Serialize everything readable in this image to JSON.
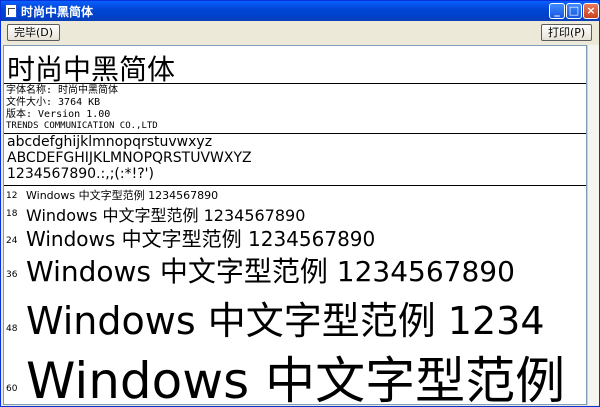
{
  "window": {
    "title": "时尚中黑简体"
  },
  "toolbar": {
    "done_label": "完毕(D)",
    "print_label": "打印(P)"
  },
  "preview": {
    "font_name": "时尚中黑简体",
    "info": [
      "字体名称: 时尚中黑简体",
      "文件大小: 3764 KB",
      "版本: Version  1.00",
      "TRENDS COMMUNICATION CO.,LTD"
    ],
    "lowercase": "abcdefghijklmnopqrstuvwxyz",
    "uppercase": "ABCDEFGHIJKLMNOPQRSTUVWXYZ",
    "digits": "1234567890.:,;(:*!?')",
    "samples": [
      {
        "size": "12",
        "text": "Windows 中文字型范例 1234567890"
      },
      {
        "size": "18",
        "text": "Windows 中文字型范例 1234567890"
      },
      {
        "size": "24",
        "text": "Windows 中文字型范例 1234567890"
      },
      {
        "size": "36",
        "text": "Windows 中文字型范例 1234567890"
      },
      {
        "size": "48",
        "text": "Windows 中文字型范例 1234"
      },
      {
        "size": "60",
        "text": "Windows 中文字型范例"
      }
    ]
  }
}
